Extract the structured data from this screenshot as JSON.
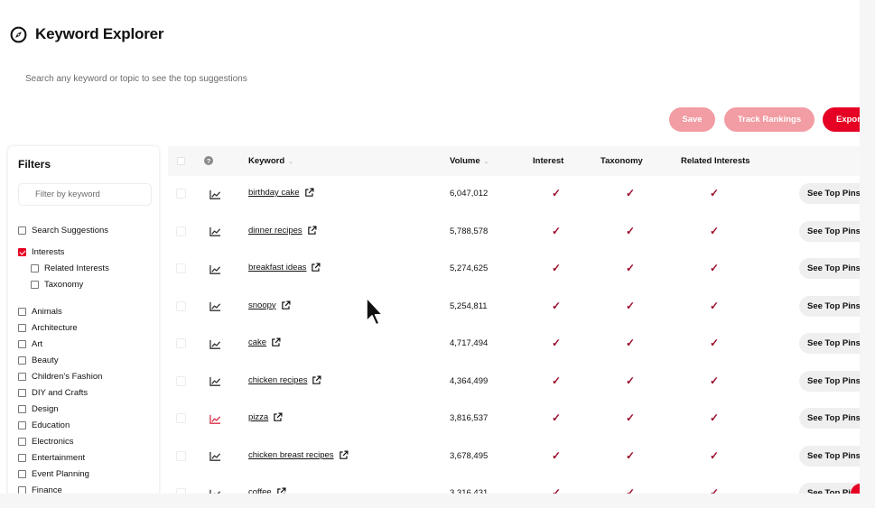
{
  "header": {
    "title": "Keyword Explorer",
    "search_placeholder": "Search any keyword or topic to see the top suggestions"
  },
  "actions": {
    "save": "Save",
    "track_rankings": "Track Rankings",
    "export": "Expor"
  },
  "filters": {
    "title": "Filters",
    "filter_placeholder": "Filter by keyword",
    "options": [
      {
        "label": "Search Suggestions",
        "checked": false
      },
      {
        "label": "Interests",
        "checked": true
      },
      {
        "label": "Related Interests",
        "checked": false
      },
      {
        "label": "Taxonomy",
        "checked": false
      },
      {
        "label": "Animals",
        "checked": false
      },
      {
        "label": "Architecture",
        "checked": false
      },
      {
        "label": "Art",
        "checked": false
      },
      {
        "label": "Beauty",
        "checked": false
      },
      {
        "label": "Children's Fashion",
        "checked": false
      },
      {
        "label": "DIY and Crafts",
        "checked": false
      },
      {
        "label": "Design",
        "checked": false
      },
      {
        "label": "Education",
        "checked": false
      },
      {
        "label": "Electronics",
        "checked": false
      },
      {
        "label": "Entertainment",
        "checked": false
      },
      {
        "label": "Event Planning",
        "checked": false
      },
      {
        "label": "Finance",
        "checked": false
      }
    ]
  },
  "table": {
    "columns": {
      "help": "?",
      "keyword": "Keyword",
      "volume": "Volume",
      "interest": "Interest",
      "taxonomy": "Taxonomy",
      "related_interests": "Related Interests"
    },
    "check_mark": "✓",
    "sort_mark": "⌄",
    "see_top_pins": "See Top Pins",
    "rows": [
      {
        "keyword": "birthday cake",
        "volume": "6,047,012"
      },
      {
        "keyword": "dinner recipes",
        "volume": "5,788,578"
      },
      {
        "keyword": "breakfast ideas",
        "volume": "5,274,625"
      },
      {
        "keyword": "snoopy",
        "volume": "5,254,811"
      },
      {
        "keyword": "cake",
        "volume": "4,717,494"
      },
      {
        "keyword": "chicken recipes",
        "volume": "4,364,499"
      },
      {
        "keyword": "pizza",
        "volume": "3,816,537"
      },
      {
        "keyword": "chicken breast recipes",
        "volume": "3,678,495"
      },
      {
        "keyword": "coffee",
        "volume": "3,316,431"
      }
    ]
  },
  "colors": {
    "brand_red": "#e60023",
    "disabled_red": "#f29ca3",
    "check_red": "#9b0a2a",
    "trend_dark": "#333333",
    "trend_red": "#d6304a"
  },
  "icons": {
    "title": "compass-icon",
    "trend": "trend-chart-icon",
    "external": "external-link-icon",
    "help": "help-icon"
  }
}
